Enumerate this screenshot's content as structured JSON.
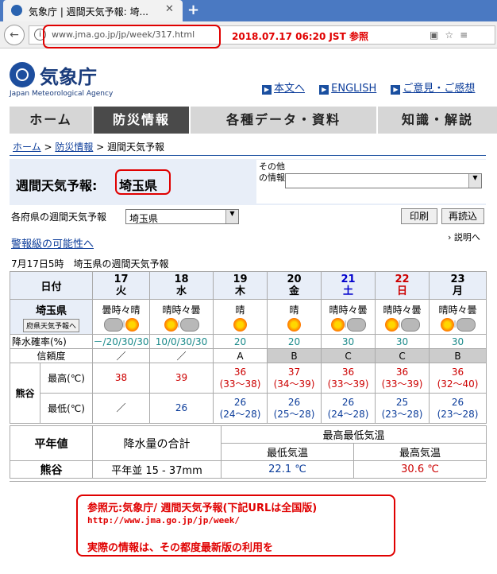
{
  "browser": {
    "tab_title": "気象庁 | 週間天気予報: 埼...",
    "tab_close": "✕",
    "new_tab": "+",
    "url": "www.jma.go.jp/jp/week/317.html",
    "annotation": "2018.07.17 06:20 JST 参照"
  },
  "header": {
    "agency_name": "気象庁",
    "agency_name_en": "Japan Meteorological Agency",
    "links": [
      "本文へ",
      "ENGLISH",
      "ご意見・ご感想"
    ]
  },
  "nav": [
    "ホーム",
    "防災情報",
    "各種データ・資料",
    "知識・解説"
  ],
  "breadcrumb": {
    "home": "ホーム",
    "sep": " > ",
    "disaster": "防災情報",
    "current": "週間天気予報"
  },
  "panel": {
    "title": "週間天気予報:",
    "prefecture": "埼玉県",
    "other_label": "その他の情報",
    "other_value": ""
  },
  "regional": {
    "label": "各府県の週間天気予報",
    "select_value": "埼玉県",
    "print_button": "印刷",
    "reload_button": "再読込"
  },
  "warning_link": "警報級の可能性へ",
  "explain_link": "説明へ",
  "caption": "7月17日5時　埼玉県の週間天気予報",
  "table": {
    "date_label": "日付",
    "days": [
      {
        "date": "17",
        "dow": "火",
        "cls": ""
      },
      {
        "date": "18",
        "dow": "水",
        "cls": ""
      },
      {
        "date": "19",
        "dow": "木",
        "cls": ""
      },
      {
        "date": "20",
        "dow": "金",
        "cls": ""
      },
      {
        "date": "21",
        "dow": "土",
        "cls": "sat"
      },
      {
        "date": "22",
        "dow": "日",
        "cls": "sun"
      },
      {
        "date": "23",
        "dow": "月",
        "cls": ""
      }
    ],
    "area": "埼玉県",
    "pref_button": "府県天気予報へ",
    "weather": [
      "曇時々晴",
      "晴時々曇",
      "晴",
      "晴",
      "晴時々曇",
      "晴時々曇",
      "晴時々曇"
    ],
    "icons": [
      [
        "cloud",
        "sun"
      ],
      [
        "sun",
        "cloud"
      ],
      [
        "sun"
      ],
      [
        "sun"
      ],
      [
        "sun",
        "cloud"
      ],
      [
        "sun",
        "cloud"
      ],
      [
        "sun",
        "cloud"
      ]
    ],
    "precip_label": "降水確率(%)",
    "precip": [
      "－/20/30/30",
      "10/0/30/30",
      "20",
      "20",
      "30",
      "30",
      "30"
    ],
    "reliability_label": "信頼度",
    "reliability": [
      "／",
      "／",
      "A",
      "B",
      "C",
      "C",
      "B"
    ],
    "station": "熊谷",
    "max_label": "最高(℃)",
    "max": [
      "38",
      "39",
      "36",
      "37",
      "36",
      "36",
      "36"
    ],
    "max_range": [
      "",
      "",
      "(33～38)",
      "(34～39)",
      "(33～39)",
      "(33～39)",
      "(32～40)"
    ],
    "min_label": "最低(℃)",
    "min": [
      "／",
      "26",
      "26",
      "26",
      "26",
      "25",
      "26"
    ],
    "min_range": [
      "",
      "",
      "(24～28)",
      "(25～28)",
      "(24～28)",
      "(23～28)",
      "(23～28)"
    ]
  },
  "normals": {
    "label": "平年値",
    "precip_sum": "降水量の合計",
    "temp_label": "最高最低気温",
    "min_temp": "最低気温",
    "max_temp": "最高気温",
    "station": "熊谷",
    "precip_value": "平年並 15 - 37mm",
    "min_value": "22.1 ℃",
    "max_value": "30.6 ℃"
  },
  "note": {
    "line1": "参照元:気象庁/ 週間天気予報(下記URLは全国版)",
    "line2": "http://www.jma.go.jp/jp/week/",
    "line3": "実際の情報は、その都度最新版の利用を"
  },
  "colors": {
    "tabbar": "#4a79c2",
    "annotation": "#e00000",
    "nav_active": "#4a4a4a"
  }
}
